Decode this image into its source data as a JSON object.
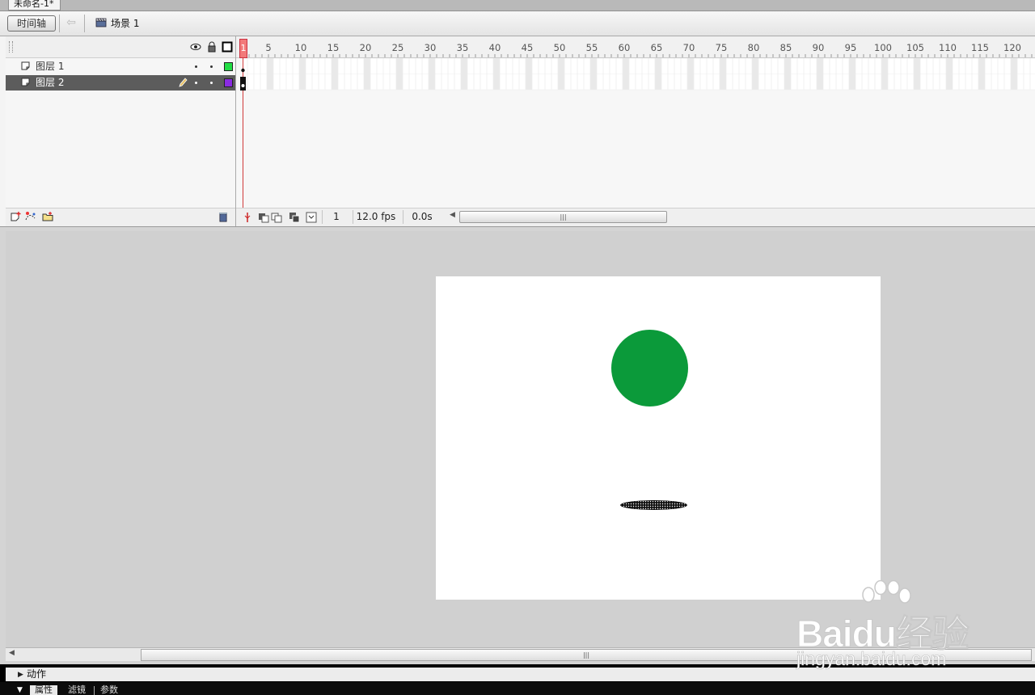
{
  "document_tab": {
    "label": "未命名-1*"
  },
  "edit_bar": {
    "timeline_button": "时间轴",
    "scene_label": "场景 1"
  },
  "timeline": {
    "ruler_ticks": [
      "1",
      "5",
      "10",
      "15",
      "20",
      "25",
      "30",
      "35",
      "40",
      "45",
      "50",
      "55",
      "60",
      "65",
      "70",
      "75",
      "80",
      "85",
      "90",
      "95",
      "100",
      "105",
      "110",
      "115",
      "120"
    ],
    "current_frame_marker": "1",
    "layers": [
      {
        "name": "图层 1",
        "color": "#22dd44",
        "selected": false
      },
      {
        "name": "图层 2",
        "color": "#8a2be2",
        "selected": true
      }
    ],
    "footer": {
      "current_frame": "1",
      "frame_rate": "12.0 fps",
      "elapsed_time": "0.0s"
    }
  },
  "stage": {
    "background_color": "#ffffff",
    "ball_color": "#0b9a3a",
    "shadow_color": "#111111"
  },
  "panels": {
    "actions_label": "动作",
    "tabs": [
      "属性",
      "滤镜",
      "参数"
    ]
  },
  "watermark": {
    "text_main": "Baidu经验",
    "text_url": "jingyan.baidu.com"
  }
}
